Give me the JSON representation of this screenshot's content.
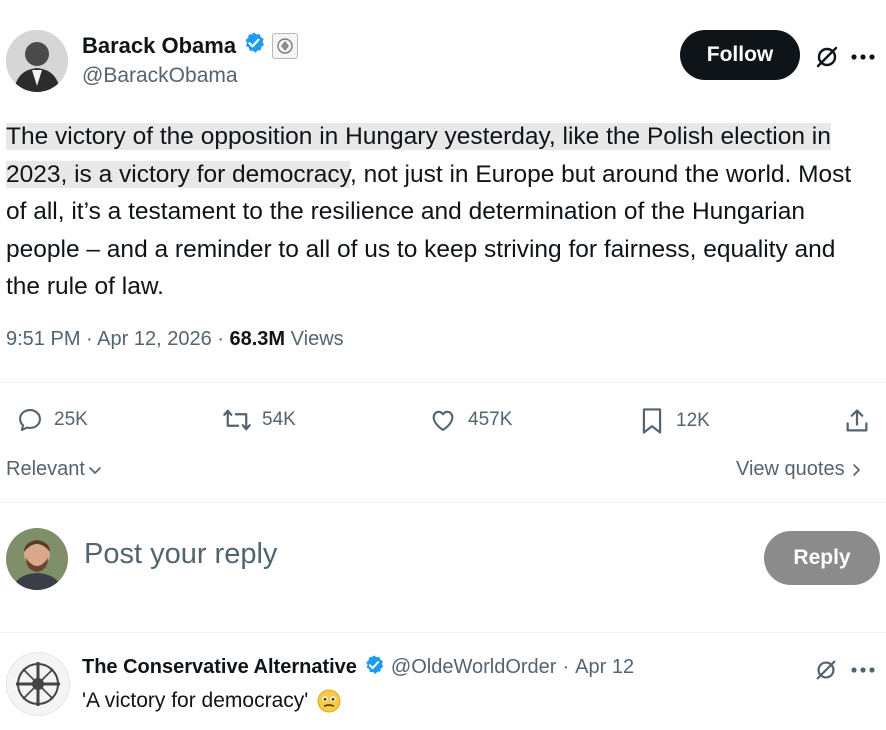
{
  "tweet": {
    "author_name": "Barack Obama",
    "author_handle": "@BarackObama",
    "follow_label": "Follow",
    "text_highlighted": "The victory of the opposition in Hungary yesterday, like the Polish election in 2023, is a victory for democracy",
    "text_rest": ", not just in Europe but around the world. Most of all, it’s a testament to the resilience and determination of the Hungarian people – and a reminder to all of us to keep striving for fairness, equality and the rule of law.",
    "time": "9:51 PM",
    "date": "Apr 12, 2026",
    "views_count": "68.3M",
    "views_label": "Views",
    "sep": "·"
  },
  "actions": {
    "replies": "25K",
    "reposts": "54K",
    "likes": "457K",
    "bookmarks": "12K"
  },
  "sort": {
    "label": "Relevant"
  },
  "quotes": {
    "label": "View quotes"
  },
  "composer": {
    "placeholder": "Post your reply",
    "reply_label": "Reply"
  },
  "reply": {
    "author_name": "The Conservative Alternative",
    "author_handle": "@OldeWorldOrder",
    "date": "Apr 12",
    "text": "'A victory for democracy'"
  },
  "colors": {
    "accent": "#1d9bf0",
    "text": "#0f1419",
    "muted": "#536471"
  },
  "icons": [
    "verified-badge-icon",
    "government-seal-icon",
    "grok-icon",
    "more-icon",
    "reply-icon",
    "repost-icon",
    "like-icon",
    "bookmark-icon",
    "share-icon",
    "chevron-down-icon",
    "chevron-right-icon",
    "emoji-icon"
  ]
}
